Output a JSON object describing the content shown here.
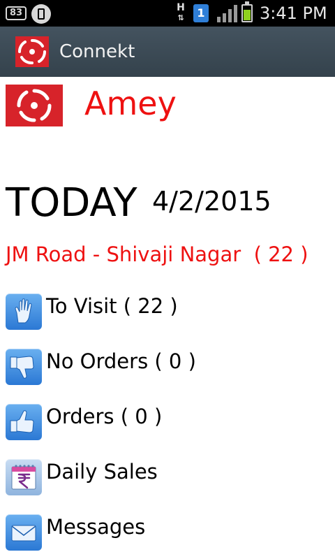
{
  "status_bar": {
    "battery_percent": "83",
    "network_type": "H",
    "sim_slot": "1",
    "time": "3:41 PM",
    "battery_level": 0.75
  },
  "action_bar": {
    "title": "Connekt",
    "logo_icon": "connekt-logo-icon"
  },
  "user": {
    "name": "Amey",
    "logo_icon": "company-logo-icon"
  },
  "today": {
    "label": "TODAY",
    "date": "4/2/2015"
  },
  "route": {
    "name": "JM Road - Shivaji Nagar  ( 22 )"
  },
  "menu": [
    {
      "label": "To Visit ( 22 )",
      "icon": "hand-icon"
    },
    {
      "label": "No Orders ( 0 )",
      "icon": "thumbs-down-icon"
    },
    {
      "label": "Orders ( 0 )",
      "icon": "thumbs-up-icon"
    },
    {
      "label": "Daily Sales",
      "icon": "rupee-calendar-icon"
    },
    {
      "label": "Messages",
      "icon": "envelope-icon"
    }
  ],
  "colors": {
    "brand_red": "#d7232a",
    "accent_red": "#ee1111",
    "action_bar": "#3c4a55",
    "icon_blue": "#2b78d4"
  }
}
